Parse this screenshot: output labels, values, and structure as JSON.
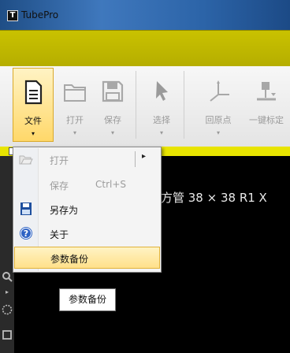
{
  "window": {
    "title": "TubePro",
    "app_icon_letter": "T"
  },
  "ribbon": {
    "buttons": [
      {
        "label": "文件",
        "icon": "document-icon",
        "active": true
      },
      {
        "label": "打开",
        "icon": "folder-icon"
      },
      {
        "label": "保存",
        "icon": "floppy-save-icon"
      },
      {
        "label": "选择",
        "icon": "cursor-arrow-icon"
      },
      {
        "label": "回原点",
        "icon": "origin-axis-icon"
      },
      {
        "label": "一键标定",
        "icon": "calibrate-icon"
      }
    ],
    "dropdown_arrow": "▾"
  },
  "file_menu": {
    "items": [
      {
        "label": "打开",
        "icon": "open-folder-icon",
        "disabled": true,
        "submenu_arrow": "▸"
      },
      {
        "label": "保存",
        "shortcut": "Ctrl+S",
        "disabled": true
      },
      {
        "label": "另存为",
        "icon": "save-as-icon"
      },
      {
        "label": "关于",
        "icon": "help-icon"
      },
      {
        "label": "参数备份",
        "highlighted": true
      }
    ]
  },
  "tooltip": {
    "text": "参数备份"
  },
  "canvas": {
    "text": "方管 38 × 38 R1 X"
  },
  "colors": {
    "title_yellow": "#c9c200",
    "accent_yellow": "#e8e400",
    "canvas_bg": "#000000"
  }
}
